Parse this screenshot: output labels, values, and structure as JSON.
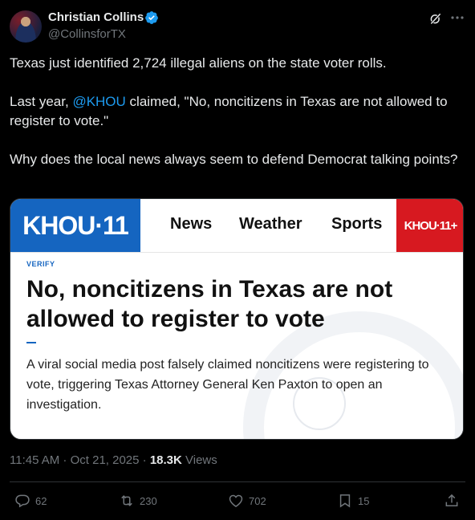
{
  "author": {
    "name": "Christian Collins",
    "handle": "@CollinsforTX"
  },
  "tweet": {
    "line1": "Texas just identified 2,724 illegal aliens on the state voter rolls.",
    "line2_prefix": "Last year, ",
    "line2_mention": "@KHOU",
    "line2_suffix": " claimed, \"No, noncitizens in Texas are not allowed to register to vote.\"",
    "line3": "Why does the local news always seem to defend Democrat talking points?"
  },
  "card": {
    "logo": "KHOU·11",
    "nav": [
      "News",
      "Weather",
      "Sports"
    ],
    "plus_logo": "KHOU·11+",
    "tag": "VERIFY",
    "headline": "No, noncitizens in Texas are not allowed to register to vote",
    "summary": "A viral social media post falsely claimed noncitizens were registering to vote, triggering Texas Attorney General Ken Paxton to open an investigation."
  },
  "meta": {
    "time_date": "11:45 AM · Oct 21, 2025 · ",
    "views_count": "18.3K",
    "views_label": " Views"
  },
  "actions": {
    "replies": "62",
    "reposts": "230",
    "likes": "702",
    "bookmarks": "15"
  },
  "colors": {
    "accent": "#1d9bf0",
    "khou_blue": "#1565c0",
    "khou_red": "#d71920"
  }
}
